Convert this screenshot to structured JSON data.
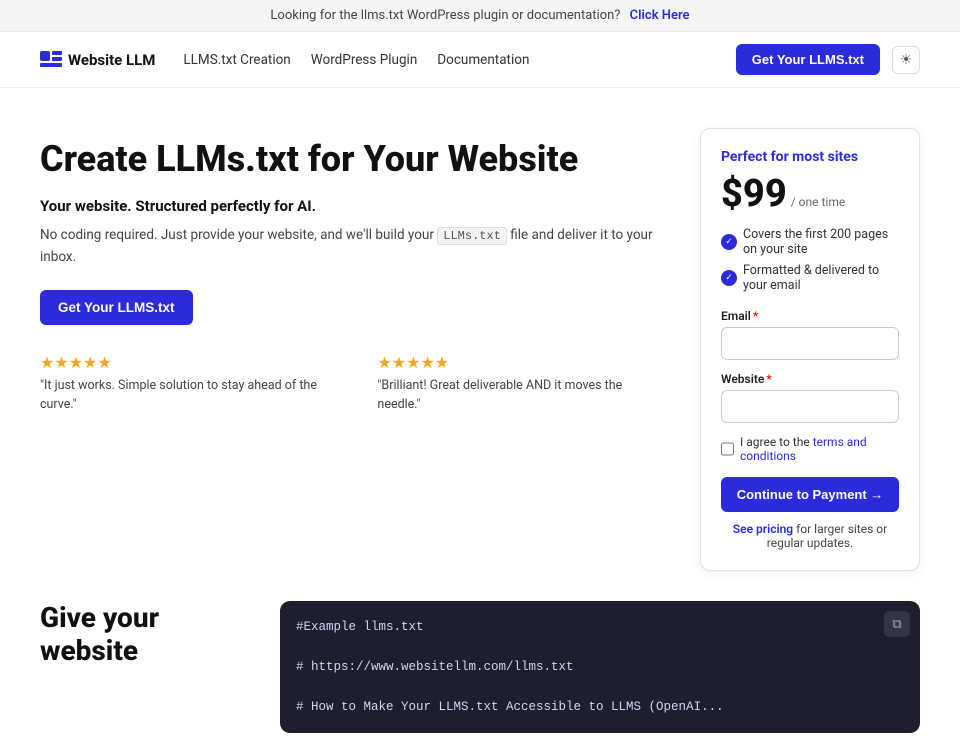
{
  "banner": {
    "text": "Looking for the llms.txt WordPress plugin or documentation?",
    "link_text": "Click Here"
  },
  "nav": {
    "logo_text": "Website LLM",
    "links": [
      {
        "label": "LLMS.txt Creation",
        "href": "#"
      },
      {
        "label": "WordPress Plugin",
        "href": "#"
      },
      {
        "label": "Documentation",
        "href": "#"
      }
    ],
    "cta_label": "Get Your LLMS.txt"
  },
  "hero": {
    "title": "Create LLMs.txt for Your Website",
    "subtitle": "Your website. Structured perfectly for AI.",
    "description_1": "No coding required. Just provide your website, and we'll build your",
    "code_snippet": "LLMs.txt",
    "description_2": "file and deliver it to your inbox.",
    "cta_label": "Get Your LLMS.txt"
  },
  "reviews": [
    {
      "stars": "★★★★★",
      "text": "\"It just works. Simple solution to stay ahead of the curve.\""
    },
    {
      "stars": "★★★★★",
      "text": "\"Brilliant! Great deliverable AND it moves the needle.\""
    }
  ],
  "pricing": {
    "badge": "Perfect for most sites",
    "price": "$99",
    "price_note": "/ one time",
    "features": [
      "Covers the first 200 pages on your site",
      "Formatted & delivered to your email"
    ],
    "form": {
      "email_label": "Email",
      "website_label": "Website",
      "checkbox_label": "I agree to the",
      "terms_link_text": "terms and conditions",
      "submit_label": "Continue to Payment →"
    },
    "see_pricing_text": "See pricing",
    "see_pricing_suffix": "for larger sites or regular updates."
  },
  "code_section": {
    "title": "Give your website",
    "lines": [
      "#Example llms.txt",
      "",
      "# https://www.websitellm.com/llms.txt",
      "",
      "# How to Make Your LLMS.txt Accessible to LLMS (OpenAI..."
    ]
  }
}
